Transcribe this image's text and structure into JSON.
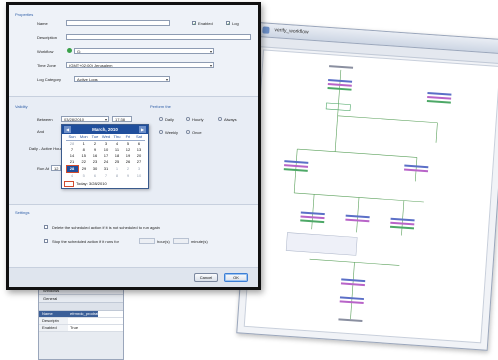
{
  "workflow_window": {
    "title": "verify_workflow",
    "node_colors": [
      "#5b6fc7",
      "#b864c8",
      "#4da867",
      "#8a8fa0"
    ],
    "tooltip_lines": [
      "...",
      "..."
    ]
  },
  "properties_panel": {
    "tabs": [
      "Windows",
      "General"
    ],
    "rows": [
      {
        "key": "Name",
        "value": "efrmrdc_prodrat"
      },
      {
        "key": "Descriptn",
        "value": ""
      },
      {
        "key": "Enabled",
        "value": "True"
      }
    ]
  },
  "dialog": {
    "properties": {
      "header": "Properties",
      "name_label": "Name",
      "name_value": "",
      "enabled_label": "Enabled",
      "enabled_checked": true,
      "log_label": "Log",
      "log_checked": true,
      "description_label": "Description",
      "description_value": "",
      "workflow_label": "Workflow",
      "workflow_value": "G:",
      "timezone_label": "Time Zone",
      "timezone_value": "(GMT+02:00) Jerusalem",
      "logcategory_label": "Log Category",
      "logcategory_value": "Active Logs"
    },
    "validity": {
      "header": "Validity",
      "between_label": "Between",
      "between_date": "03/28/2010",
      "between_time": "17:38",
      "and_label": "And",
      "daily_label": "Daily - Active Hours",
      "runat_label": "Run At",
      "runat_value": "12",
      "perform_header": "Perform the",
      "options": [
        "Daily",
        "Hourly",
        "Always",
        "Weekly",
        "Once"
      ]
    },
    "calendar": {
      "month_label": "March, 2010",
      "weekdays": [
        "Sun",
        "Mon",
        "Tue",
        "Wed",
        "Thu",
        "Fri",
        "Sat"
      ],
      "weeks": [
        [
          "28",
          "1",
          "2",
          "3",
          "4",
          "5",
          "6"
        ],
        [
          "7",
          "8",
          "9",
          "10",
          "11",
          "12",
          "13"
        ],
        [
          "14",
          "15",
          "16",
          "17",
          "18",
          "19",
          "20"
        ],
        [
          "21",
          "22",
          "23",
          "24",
          "25",
          "26",
          "27"
        ],
        [
          "28",
          "29",
          "30",
          "31",
          "1",
          "2",
          "3"
        ],
        [
          "4",
          "5",
          "6",
          "7",
          "8",
          "9",
          "10"
        ]
      ],
      "selected_day": "28",
      "today_label": "Today: 3/28/2010",
      "prev_icon": "chevron-left-icon",
      "next_icon": "chevron-right-icon"
    },
    "settings": {
      "header": "Settings",
      "option1": "Delete the scheduled action if it is not scheduled to run again",
      "option2_prefix": "Stop the scheduled action if it runs for",
      "hours_label": "hour(s)",
      "minutes_label": "minute(s)"
    },
    "buttons": {
      "cancel": "Cancel",
      "ok": "OK"
    }
  }
}
